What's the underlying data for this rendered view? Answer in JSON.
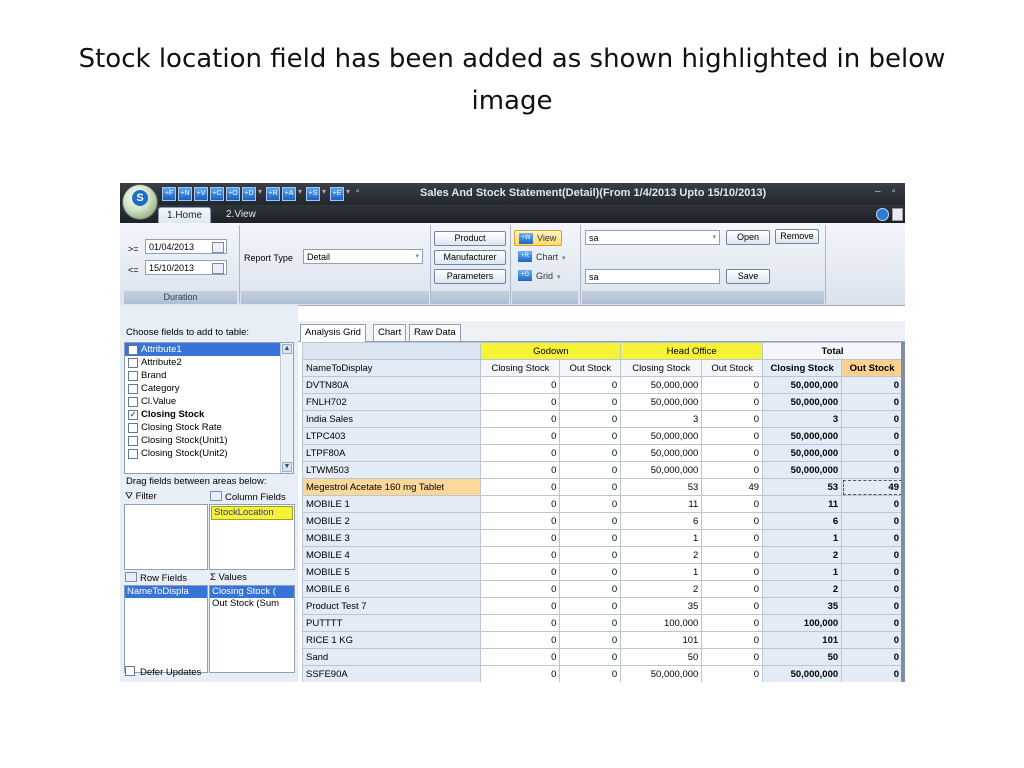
{
  "slide": {
    "title": "Stock location field has been added as shown highlighted in below image"
  },
  "app": {
    "window_title": "Sales And Stock Statement(Detail)(From 1/4/2013 Upto 15/10/2013)",
    "tabs": [
      "1.Home",
      "2.View"
    ],
    "ribbon": {
      "from_op": ">=",
      "from_date": "01/04/2013",
      "to_op": "<=",
      "to_date": "15/10/2013",
      "duration_label": "Duration",
      "report_type_label": "Report Type",
      "report_type_value": "Detail",
      "product_btn": "Product",
      "manufacturer_btn": "Manufacturer",
      "parameters_btn": "Parameters",
      "view_btn": "View",
      "chart_btn": "Chart",
      "grid_btn": "Grid",
      "layout_combo_value": "sa",
      "open_btn": "Open",
      "remove_btn": "Remove",
      "save_name_value": "sa",
      "save_btn": "Save"
    },
    "field_panel": {
      "choose_label": "Choose fields to add to table:",
      "fields": [
        {
          "label": "Attribute1",
          "checked": false,
          "selected": true
        },
        {
          "label": "Attribute2",
          "checked": false
        },
        {
          "label": "Brand",
          "checked": false
        },
        {
          "label": "Category",
          "checked": false
        },
        {
          "label": "Cl.Value",
          "checked": false
        },
        {
          "label": "Closing Stock",
          "checked": true,
          "bold": true
        },
        {
          "label": "Closing Stock Rate",
          "checked": false
        },
        {
          "label": "Closing Stock(Unit1)",
          "checked": false
        },
        {
          "label": "Closing Stock(Unit2)",
          "checked": false
        }
      ],
      "drag_label": "Drag fields between areas below:",
      "filter_label": "Filter",
      "column_fields_label": "Column Fields",
      "column_fields": [
        "StockLocation"
      ],
      "row_fields_label": "Row Fields",
      "values_label": "Values",
      "row_fields": [
        "NameToDispla"
      ],
      "values": [
        "Closing Stock (",
        "Out Stock (Sum"
      ],
      "defer_label": "Defer Updates"
    },
    "pivot": {
      "tabs": [
        "Analysis Grid",
        "Chart",
        "Raw Data"
      ],
      "godown_label": "Godown",
      "head_office_label": "Head Office",
      "total_label": "Total",
      "row_header": "NameToDisplay",
      "sub_headers": [
        "Closing Stock",
        "Out Stock",
        "Closing Stock",
        "Out Stock",
        "Closing Stock",
        "Out Stock"
      ],
      "rows": [
        {
          "name": "DVTN80A",
          "g_cs": "0",
          "g_os": "0",
          "h_cs": "50,000,000",
          "h_os": "0",
          "t_cs": "50,000,000",
          "t_os": "0"
        },
        {
          "name": "FNLH702",
          "g_cs": "0",
          "g_os": "0",
          "h_cs": "50,000,000",
          "h_os": "0",
          "t_cs": "50,000,000",
          "t_os": "0"
        },
        {
          "name": "India Sales",
          "g_cs": "0",
          "g_os": "0",
          "h_cs": "3",
          "h_os": "0",
          "t_cs": "3",
          "t_os": "0"
        },
        {
          "name": "LTPC403",
          "g_cs": "0",
          "g_os": "0",
          "h_cs": "50,000,000",
          "h_os": "0",
          "t_cs": "50,000,000",
          "t_os": "0"
        },
        {
          "name": "LTPF80A",
          "g_cs": "0",
          "g_os": "0",
          "h_cs": "50,000,000",
          "h_os": "0",
          "t_cs": "50,000,000",
          "t_os": "0"
        },
        {
          "name": "LTWM503",
          "g_cs": "0",
          "g_os": "0",
          "h_cs": "50,000,000",
          "h_os": "0",
          "t_cs": "50,000,000",
          "t_os": "0"
        },
        {
          "name": "Megestrol Acetate 160 mg Tablet",
          "g_cs": "0",
          "g_os": "0",
          "h_cs": "53",
          "h_os": "49",
          "t_cs": "53",
          "t_os": "49",
          "highlight": true
        },
        {
          "name": "MOBILE 1",
          "g_cs": "0",
          "g_os": "0",
          "h_cs": "11",
          "h_os": "0",
          "t_cs": "11",
          "t_os": "0"
        },
        {
          "name": "MOBILE 2",
          "g_cs": "0",
          "g_os": "0",
          "h_cs": "6",
          "h_os": "0",
          "t_cs": "6",
          "t_os": "0"
        },
        {
          "name": "MOBILE 3",
          "g_cs": "0",
          "g_os": "0",
          "h_cs": "1",
          "h_os": "0",
          "t_cs": "1",
          "t_os": "0"
        },
        {
          "name": "MOBILE 4",
          "g_cs": "0",
          "g_os": "0",
          "h_cs": "2",
          "h_os": "0",
          "t_cs": "2",
          "t_os": "0"
        },
        {
          "name": "MOBILE 5",
          "g_cs": "0",
          "g_os": "0",
          "h_cs": "1",
          "h_os": "0",
          "t_cs": "1",
          "t_os": "0"
        },
        {
          "name": "MOBILE 6",
          "g_cs": "0",
          "g_os": "0",
          "h_cs": "2",
          "h_os": "0",
          "t_cs": "2",
          "t_os": "0"
        },
        {
          "name": "Product Test 7",
          "g_cs": "0",
          "g_os": "0",
          "h_cs": "35",
          "h_os": "0",
          "t_cs": "35",
          "t_os": "0"
        },
        {
          "name": "PUTTTT",
          "g_cs": "0",
          "g_os": "0",
          "h_cs": "100,000",
          "h_os": "0",
          "t_cs": "100,000",
          "t_os": "0"
        },
        {
          "name": "RICE 1 KG",
          "g_cs": "0",
          "g_os": "0",
          "h_cs": "101",
          "h_os": "0",
          "t_cs": "101",
          "t_os": "0"
        },
        {
          "name": "Sand",
          "g_cs": "0",
          "g_os": "0",
          "h_cs": "50",
          "h_os": "0",
          "t_cs": "50",
          "t_os": "0"
        },
        {
          "name": "SSFE90A",
          "g_cs": "0",
          "g_os": "0",
          "h_cs": "50,000,000",
          "h_os": "0",
          "t_cs": "50,000,000",
          "t_os": "0"
        }
      ]
    }
  },
  "colors": {
    "accent_yellow": "#f6f235",
    "highlight_orange": "#fcd79a",
    "out_stock_header": "#fbcf8e",
    "grid_header_blue": "#e2ebf6",
    "selection_blue": "#3874d8"
  }
}
